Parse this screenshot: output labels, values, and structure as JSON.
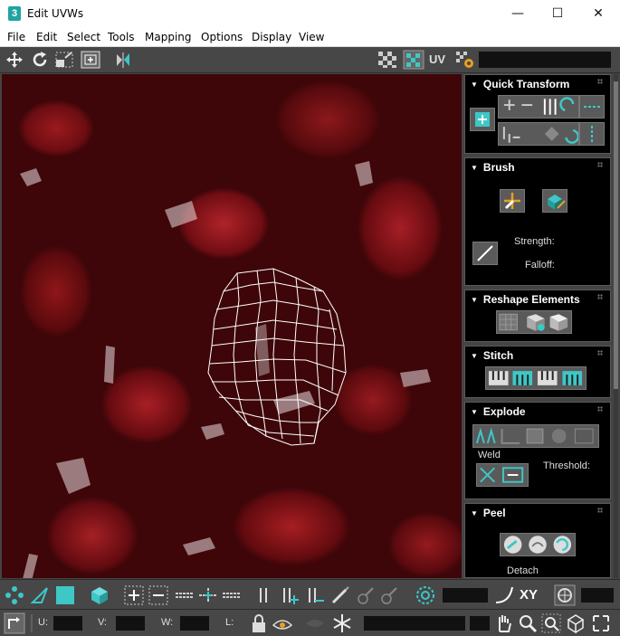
{
  "window": {
    "title": "Edit UVWs",
    "app_icon_glyph": "3",
    "minimize": "—",
    "maximize": "☐",
    "close": "✕"
  },
  "menu": [
    "File",
    "Edit",
    "Select",
    "Tools",
    "Mapping",
    "Options",
    "Display",
    "View"
  ],
  "toolbar": {
    "uv_label": "UV"
  },
  "rollouts": {
    "quick_transform": {
      "title": "Quick Transform"
    },
    "brush": {
      "title": "Brush",
      "strength_label": "Strength:",
      "falloff_label": "Falloff:"
    },
    "reshape": {
      "title": "Reshape Elements"
    },
    "stitch": {
      "title": "Stitch"
    },
    "explode": {
      "title": "Explode",
      "weld_label": "Weld",
      "threshold_label": "Threshold:"
    },
    "peel": {
      "title": "Peel",
      "detach_label": "Detach"
    }
  },
  "bottom": {
    "xy_label": "XY",
    "u_label": "U:",
    "v_label": "V:",
    "w_label": "W:",
    "l_label": "L:"
  },
  "colors": {
    "accent": "#3ec7c7",
    "panel_bg": "#000000",
    "toolbar_bg": "#474747",
    "mesh": "#ffffff"
  }
}
